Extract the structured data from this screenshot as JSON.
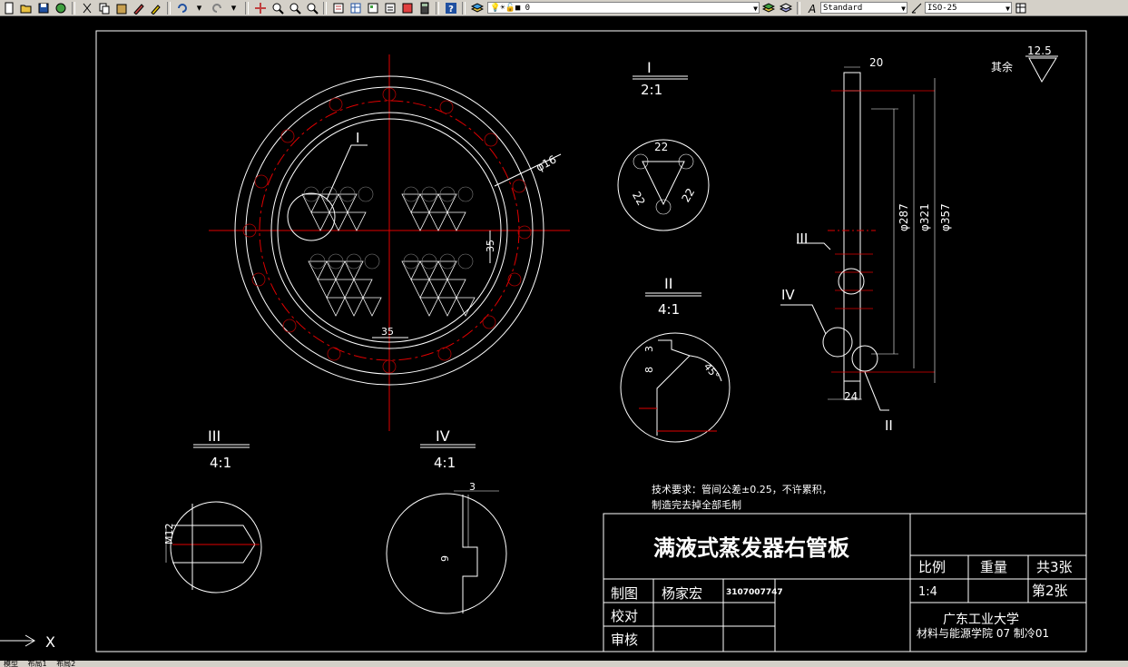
{
  "toolbar": {
    "layer_value": "0",
    "text_style": "Standard",
    "dim_style": "ISO-25"
  },
  "drawing": {
    "detail_I": {
      "label": "I",
      "scale": "2:1",
      "dim_a": "22",
      "dim_b": "22",
      "dim_c": "22"
    },
    "detail_II": {
      "label": "II",
      "scale": "4:1",
      "dim_3": "3",
      "dim_8": "8",
      "angle": "45°"
    },
    "detail_III": {
      "label": "III",
      "scale": "4:1",
      "thread": "M12"
    },
    "detail_IV": {
      "label": "IV",
      "scale": "4:1",
      "dim_3": "3",
      "dim_9": "9"
    },
    "main": {
      "callout": "I",
      "hole_dia": "φ16",
      "pitch_v": "35",
      "pitch_h": "35"
    },
    "side": {
      "top_width": "20",
      "bottom_width": "24",
      "d287": "φ287",
      "d321": "φ321",
      "d357": "φ357",
      "callout_III": "III",
      "callout_IV": "IV",
      "callout_II": "II"
    },
    "roughness": {
      "label": "其余",
      "value": "12.5"
    },
    "tech_req_line1": "技术要求：管间公差±0.25，不许累积，",
    "tech_req_line2": "制造完去掉全部毛制",
    "ucs_x": "X"
  },
  "title_block": {
    "title": "满液式蒸发器右管板",
    "ratio_label": "比例",
    "weight_label": "重量",
    "sheets_total": "共3张",
    "ratio_value": "1:4",
    "sheet_no": "第2张",
    "drawn_label": "制图",
    "drawn_by": "杨家宏",
    "student_id": "3107007747",
    "check_label": "校对",
    "review_label": "审核",
    "school": "广东工业大学",
    "dept": "材料与能源学院 07 制冷01"
  },
  "tabs": [
    "模型",
    "布局1",
    "布局2"
  ]
}
